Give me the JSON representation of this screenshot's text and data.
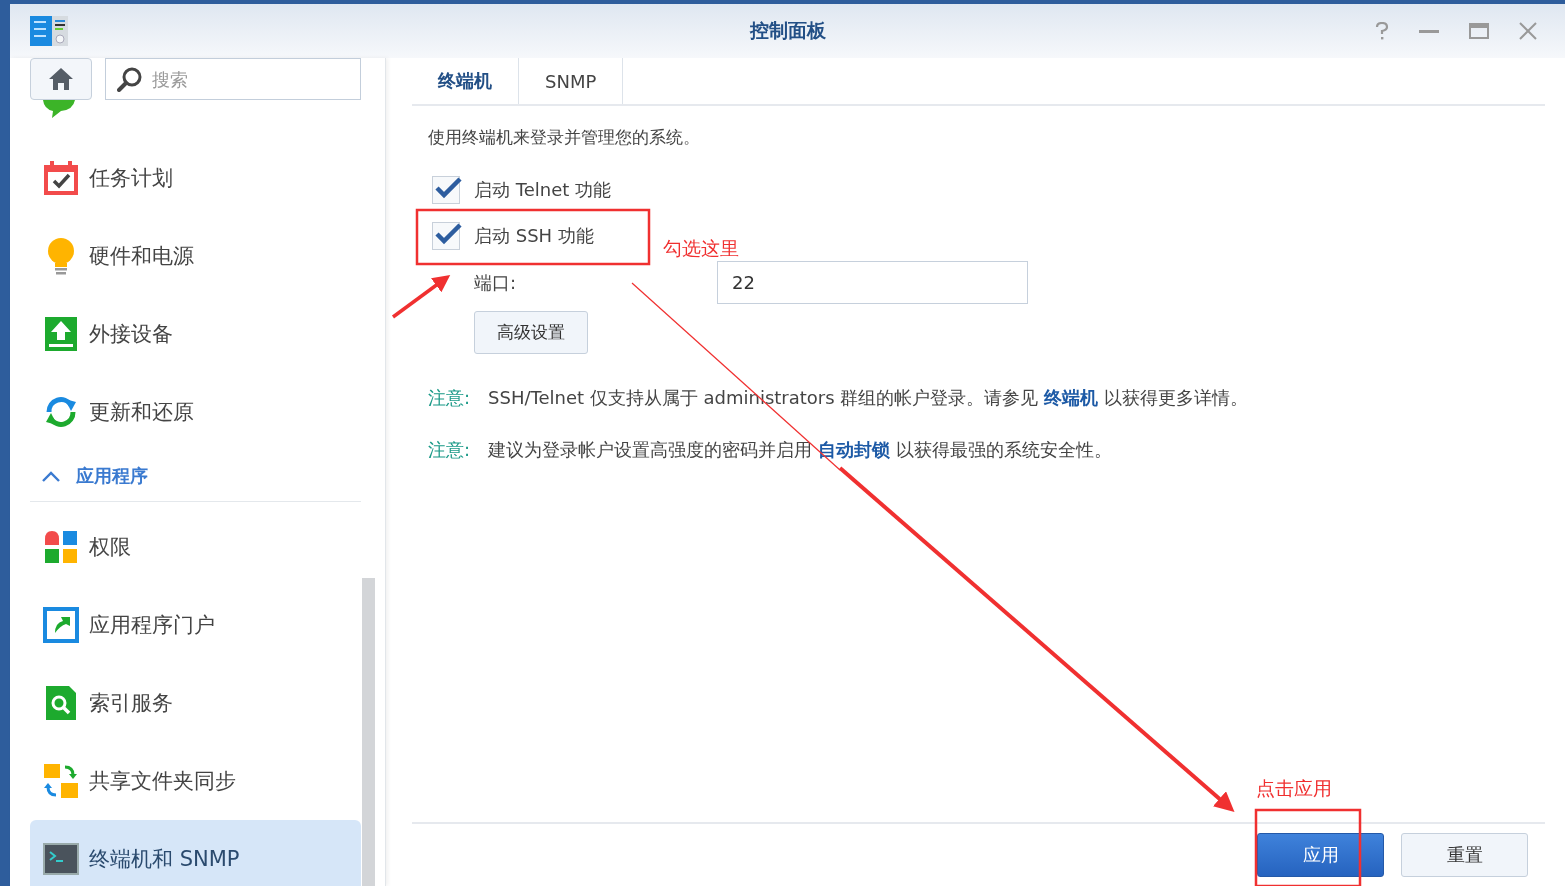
{
  "window": {
    "title": "控制面板"
  },
  "sidebar": {
    "search": {
      "placeholder": "搜索"
    },
    "items": [
      {
        "kind": "item",
        "label": "任务计划",
        "selected": false
      },
      {
        "kind": "item",
        "label": "硬件和电源",
        "selected": false
      },
      {
        "kind": "item",
        "label": "外接设备",
        "selected": false
      },
      {
        "kind": "item",
        "label": "更新和还原",
        "selected": false
      },
      {
        "kind": "section",
        "label": "应用程序",
        "expanded": true
      },
      {
        "kind": "item",
        "label": "权限",
        "selected": false
      },
      {
        "kind": "item",
        "label": "应用程序门户",
        "selected": false
      },
      {
        "kind": "item",
        "label": "索引服务",
        "selected": false
      },
      {
        "kind": "item",
        "label": "共享文件夹同步",
        "selected": false
      },
      {
        "kind": "item",
        "label": "终端机和 SNMP",
        "selected": true
      }
    ]
  },
  "tabs": [
    {
      "label": "终端机",
      "selected": true
    },
    {
      "label": "SNMP",
      "selected": false
    }
  ],
  "description": "使用终端机来登录并管理您的系统。",
  "options": [
    {
      "label": "启动 Telnet 功能",
      "checked": true
    },
    {
      "label": "启动 SSH 功能",
      "checked": true
    }
  ],
  "port": {
    "label": "端口:",
    "value": "22"
  },
  "advanced_button": "高级设置",
  "notes": [
    {
      "label": "注意:",
      "parts": [
        {
          "kind": "text",
          "text": "SSH/Telnet 仅支持从属于 administrators 群组的帐户登录。请参见 "
        },
        {
          "kind": "link",
          "text": "终端机"
        },
        {
          "kind": "text",
          "text": " 以获得更多详情。"
        }
      ]
    },
    {
      "label": "注意:",
      "parts": [
        {
          "kind": "text",
          "text": "建议为登录帐户设置高强度的密码并启用 "
        },
        {
          "kind": "link",
          "text": "自动封锁"
        },
        {
          "kind": "text",
          "text": " 以获得最强的系统安全性。"
        }
      ]
    }
  ],
  "buttons": [
    {
      "kind": "primary",
      "label": "应用"
    },
    {
      "kind": "secondary",
      "label": "重置"
    }
  ],
  "annotations": [
    {
      "text": "勾选这里"
    },
    {
      "text": "点击应用"
    }
  ]
}
